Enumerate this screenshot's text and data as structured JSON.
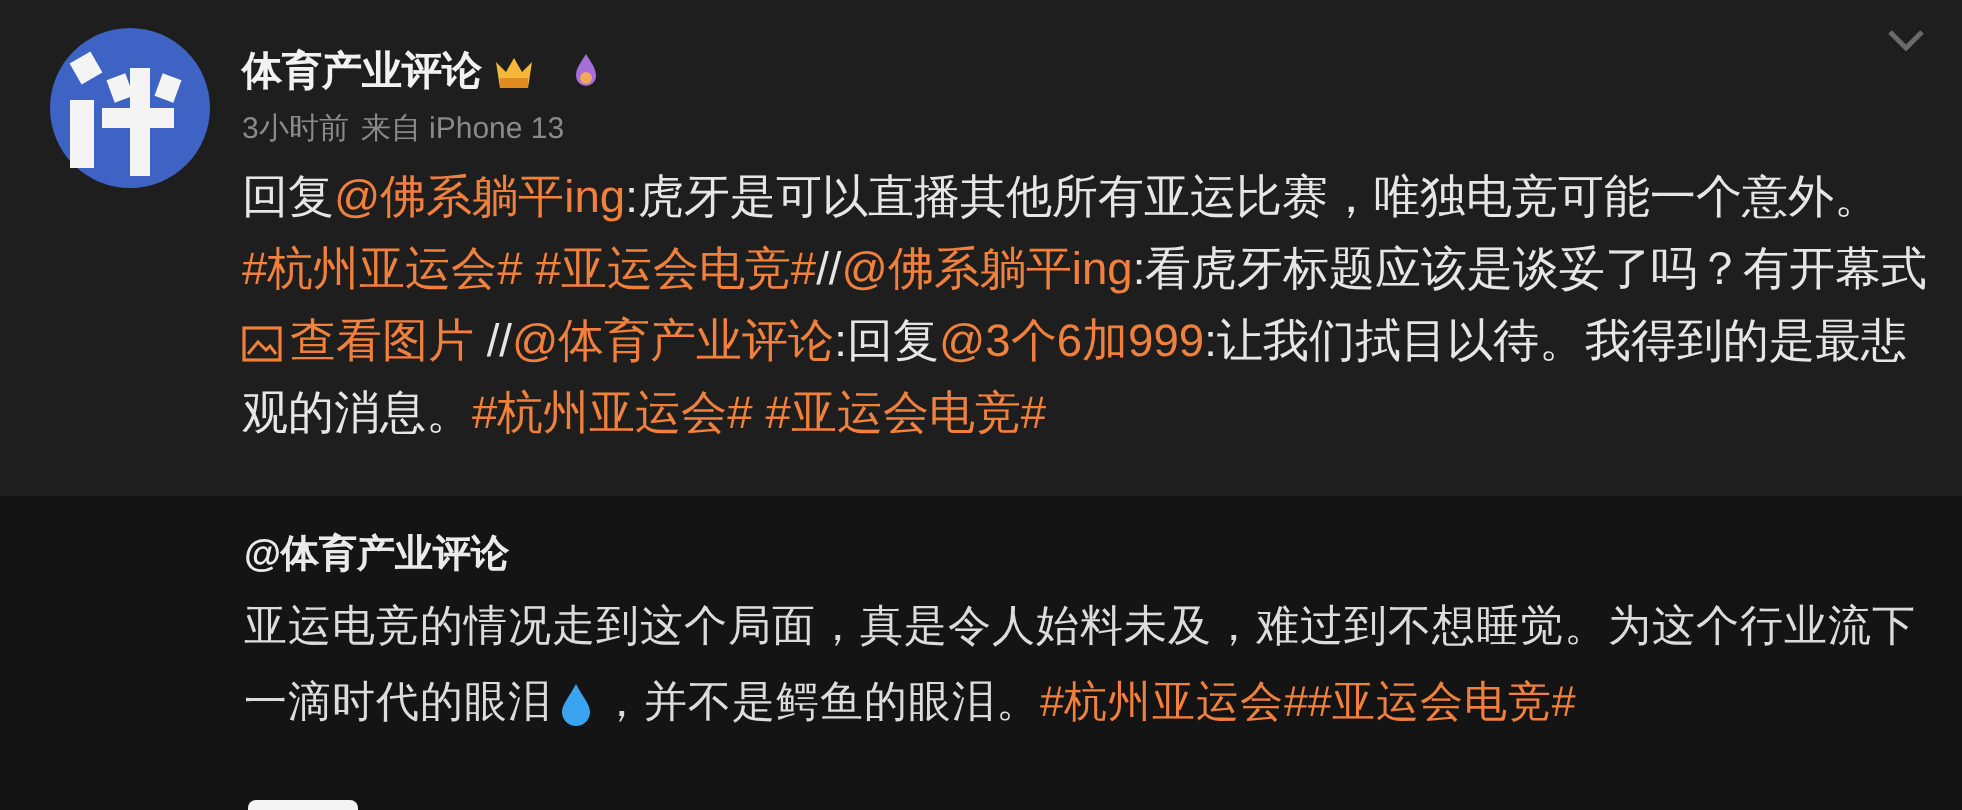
{
  "post": {
    "author": "体育产业评论",
    "time": "3小时前",
    "source": "来自 iPhone 13",
    "content": [
      {
        "kind": "text",
        "text": "回复"
      },
      {
        "kind": "mention",
        "text": "@佛系躺平ing"
      },
      {
        "kind": "text",
        "text": ":虎牙是可以直播其他所有亚运比赛，唯独电竞可能一个意外。"
      },
      {
        "kind": "topic",
        "text": "#杭州亚运会#"
      },
      {
        "kind": "topic",
        "text": " #亚运会电竞#"
      },
      {
        "kind": "text",
        "text": "//"
      },
      {
        "kind": "mention",
        "text": "@佛系躺平ing"
      },
      {
        "kind": "text",
        "text": ":看虎牙标题应该是谈妥了吗？有开幕式 "
      },
      {
        "kind": "image_link",
        "text": "查看图片"
      },
      {
        "kind": "text",
        "text": " //"
      },
      {
        "kind": "mention",
        "text": "@体育产业评论"
      },
      {
        "kind": "text",
        "text": ":回复"
      },
      {
        "kind": "mention",
        "text": "@3个6加999"
      },
      {
        "kind": "text",
        "text": ":让我们拭目以待。我得到的是最悲观的消息。"
      },
      {
        "kind": "topic",
        "text": "#杭州亚运会#"
      },
      {
        "kind": "topic",
        "text": " #亚运会电竞#"
      }
    ]
  },
  "repost": {
    "author": "@体育产业评论",
    "content": [
      {
        "kind": "text",
        "text": "亚运电竞的情况走到这个局面，真是令人始料未及，难过到不想睡觉。为这个行业流下一滴时代的眼泪"
      },
      {
        "kind": "emoji"
      },
      {
        "kind": "text",
        "text": "，并不是鳄鱼的眼泪。"
      },
      {
        "kind": "topic",
        "text": "#杭州亚运会#"
      },
      {
        "kind": "topic",
        "text": "#亚运会电竞#"
      }
    ]
  }
}
